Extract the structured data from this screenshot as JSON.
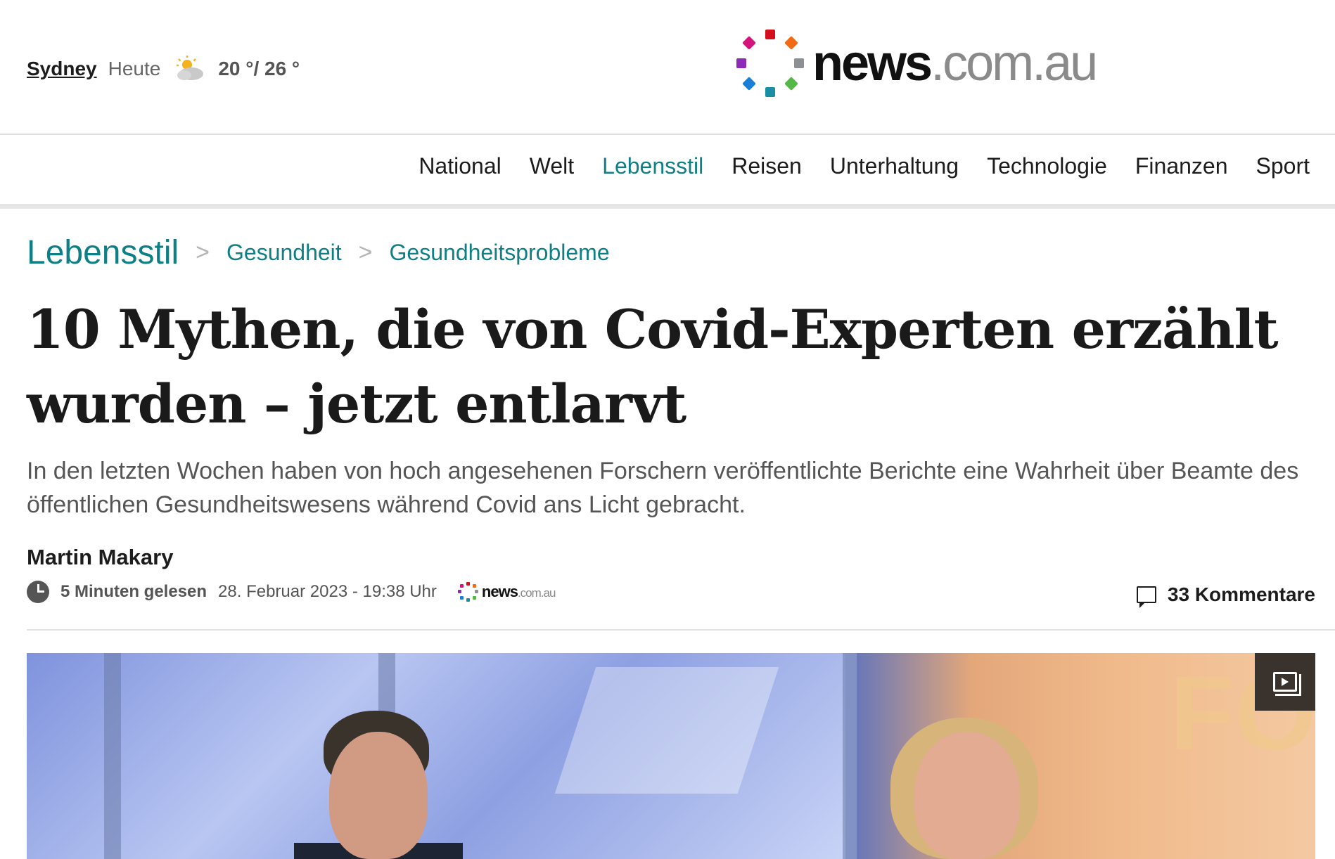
{
  "weather": {
    "city": "Sydney",
    "day": "Heute",
    "icon": "partly-cloudy-icon",
    "temps": "20 °/ 26 °"
  },
  "logo": {
    "bold": "news",
    "light": ".com.au",
    "dot_colors": [
      "#d4101c",
      "#f26b12",
      "#8c8f94",
      "#53b847",
      "#1a8fa3",
      "#1a7fd6",
      "#8d2ab8",
      "#d4147c"
    ]
  },
  "nav": {
    "items": [
      "National",
      "Welt",
      "Lebensstil",
      "Reisen",
      "Unterhaltung",
      "Technologie",
      "Finanzen",
      "Sport"
    ],
    "active": "Lebensstil",
    "accent_color": "#0f7f86"
  },
  "breadcrumb": {
    "section": "Lebensstil",
    "sub1": "Gesundheit",
    "sub2": "Gesundheitsprobleme"
  },
  "article": {
    "headline": "10 Mythen, die von Covid-Experten erzählt wurden – jetzt entlarvt",
    "standfirst": "In den letzten Wochen haben von hoch angesehenen Forschern veröffentlichte Berichte eine Wahrheit über Beamte des öffentlichen Gesundheitswesens während Covid ans Licht gebracht.",
    "author": "Martin Makary",
    "read_time": "5 Minuten gelesen",
    "date": "28. Februar 2023 - 19:38 Uhr",
    "source_bold": "news",
    "source_light": ".com.au",
    "comments": "33 Kommentare"
  },
  "video": {
    "icon": "video-gallery-icon",
    "brand_mark": "FO"
  }
}
